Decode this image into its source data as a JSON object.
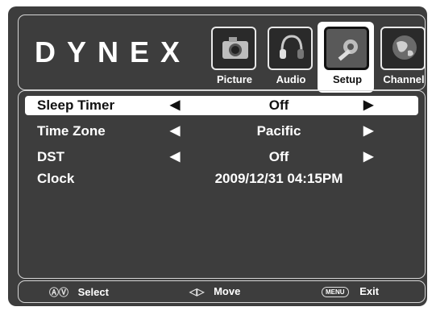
{
  "brand": {
    "logo": "DYNEX"
  },
  "tabs": [
    {
      "label": "Picture",
      "icon": "camera-icon",
      "active": false
    },
    {
      "label": "Audio",
      "icon": "headphones-icon",
      "active": false
    },
    {
      "label": "Setup",
      "icon": "wrench-icon",
      "active": true
    },
    {
      "label": "Channel",
      "icon": "globe-icon",
      "active": false
    }
  ],
  "menu": [
    {
      "name": "Sleep Timer",
      "value": "Off",
      "selected": true,
      "has_arrows": true
    },
    {
      "name": "Time Zone",
      "value": "Pacific",
      "selected": false,
      "has_arrows": true
    },
    {
      "name": "DST",
      "value": "Off",
      "selected": false,
      "has_arrows": true
    },
    {
      "name": "Clock",
      "value": "2009/12/31 04:15PM",
      "selected": false,
      "has_arrows": false
    }
  ],
  "arrows": {
    "left": "◀",
    "right": "▶"
  },
  "footer": {
    "select": {
      "symbol": "ⒶⓋ",
      "label": "Select"
    },
    "move": {
      "symbol": "◁▷",
      "label": "Move"
    },
    "exit": {
      "key": "MENU",
      "label": "Exit"
    }
  },
  "colors": {
    "background": "#3d3d3d",
    "highlight": "#ffffff",
    "text": "#ffffff"
  }
}
